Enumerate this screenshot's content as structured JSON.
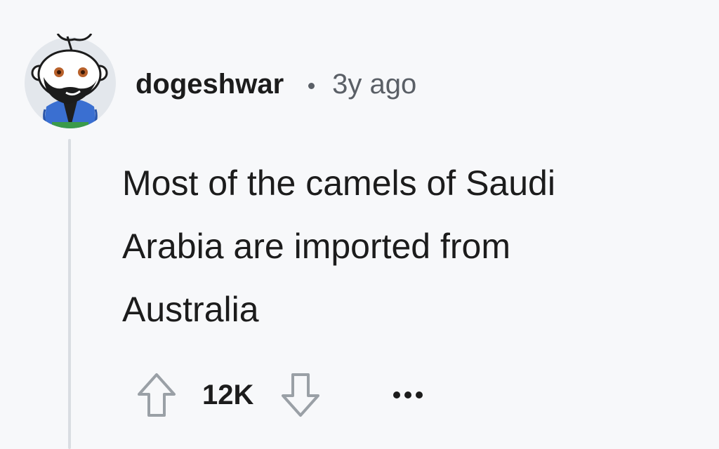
{
  "comment": {
    "author": "dogeshwar",
    "separator": "•",
    "timestamp": "3y ago",
    "body_lines": [
      "Most of the camels of Saudi",
      "Arabia are imported from",
      "Australia"
    ],
    "score": "12K"
  },
  "icons": {
    "upvote": "arrow-up-outline-icon",
    "downvote": "arrow-down-outline-icon",
    "more": "more-horizontal-icon",
    "avatar": "snoo-avatar-with-beard-and-blue-jacket"
  },
  "colors": {
    "background": "#f7f8fa",
    "text_primary": "#1c1c1c",
    "text_secondary": "#5a5f66",
    "thread_line": "#d9dde2",
    "avatar_bg": "#e3e7ec",
    "jacket": "#3a6fd1"
  }
}
